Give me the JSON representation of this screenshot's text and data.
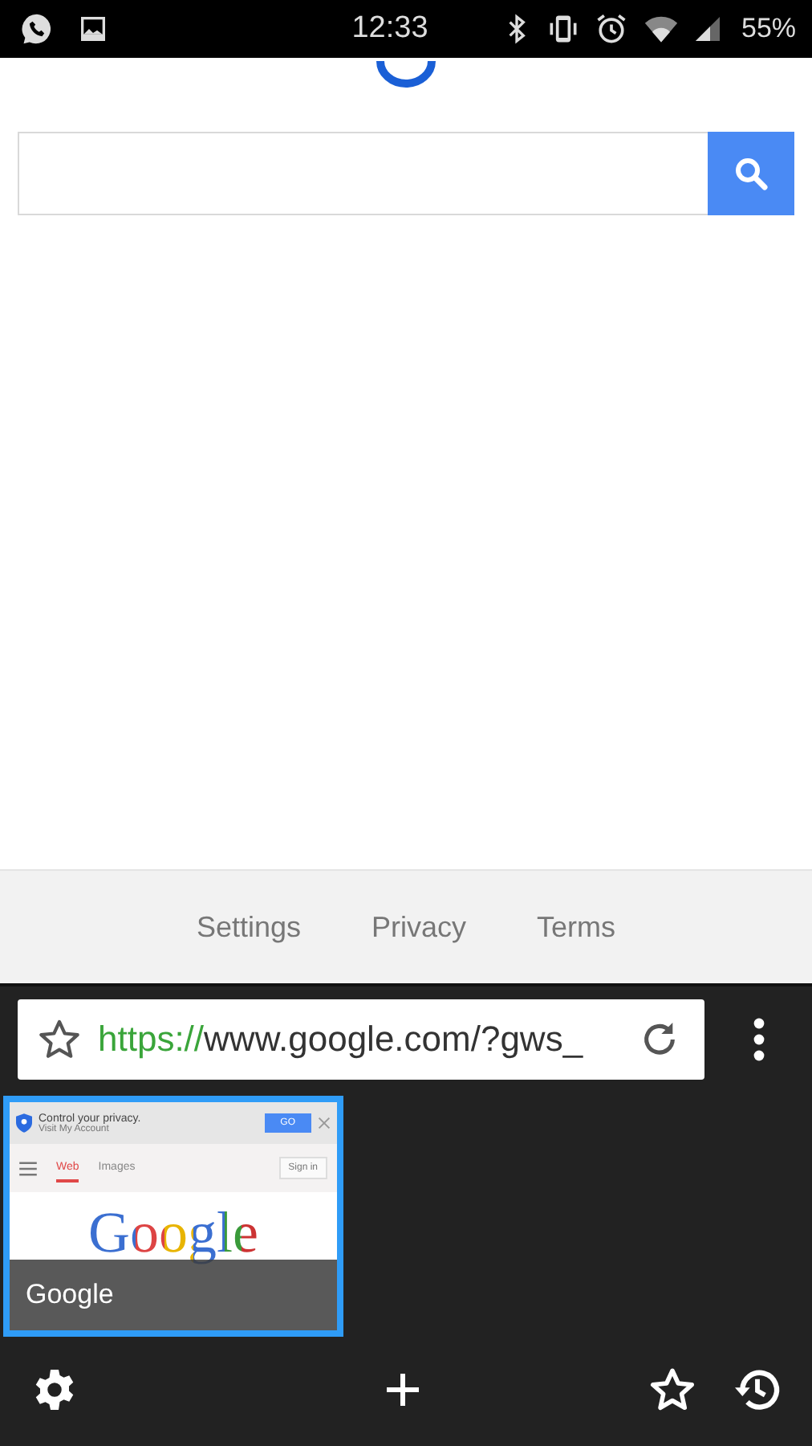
{
  "status_bar": {
    "time": "12:33",
    "battery": "55%"
  },
  "footer_links": [
    "Settings",
    "Privacy",
    "Terms"
  ],
  "address_bar": {
    "scheme": "https://",
    "rest": "www.google.com/?gws_"
  },
  "tabs": [
    {
      "title": "Google",
      "selected": true,
      "preview": {
        "banner_title": "Control your privacy.",
        "banner_link": "Visit My Account",
        "banner_button": "GO",
        "nav": [
          {
            "label": "Web",
            "selected": true
          },
          {
            "label": "Images",
            "selected": false
          }
        ],
        "sign_in": "Sign in",
        "logo": "Google"
      }
    }
  ]
}
